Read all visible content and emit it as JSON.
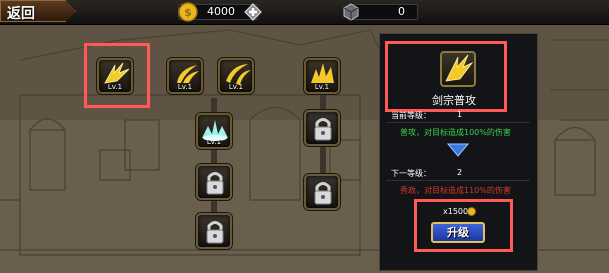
{
  "topbar": {
    "back_label": "返回",
    "gold": "4000",
    "gems": "0"
  },
  "skills": [
    {
      "level": "Lv.1",
      "icon": "sword-skill-icon"
    },
    {
      "level": "Lv.1",
      "icon": "slash-skill-icon"
    },
    {
      "level": "Lv.1",
      "icon": "double-slash-skill-icon"
    },
    {
      "level": "Lv.1",
      "icon": "burst-skill-icon"
    },
    {
      "level": "Lv.1",
      "icon": "shockwave-skill-icon"
    },
    {
      "level": "",
      "icon": "lock-icon"
    },
    {
      "level": "",
      "icon": "lock-icon"
    },
    {
      "level": "",
      "icon": "lock-icon"
    },
    {
      "level": "",
      "icon": "lock-icon"
    }
  ],
  "panel": {
    "skill_name": "剑宗普攻",
    "current_level_label": "当前等级：",
    "current_level": "1",
    "current_desc": "普攻，对目标造成100%的伤害",
    "next_level_label": "下一等级：",
    "next_level": "2",
    "next_desc": "秀政，对目标造成110%的伤害",
    "cost": "x1500",
    "upgrade_label": "升级"
  },
  "colors": {
    "highlight": "#ff5a55",
    "gold": "#f0cf36",
    "desc_current": "#3bd24b",
    "desc_next": "#d6382f"
  }
}
